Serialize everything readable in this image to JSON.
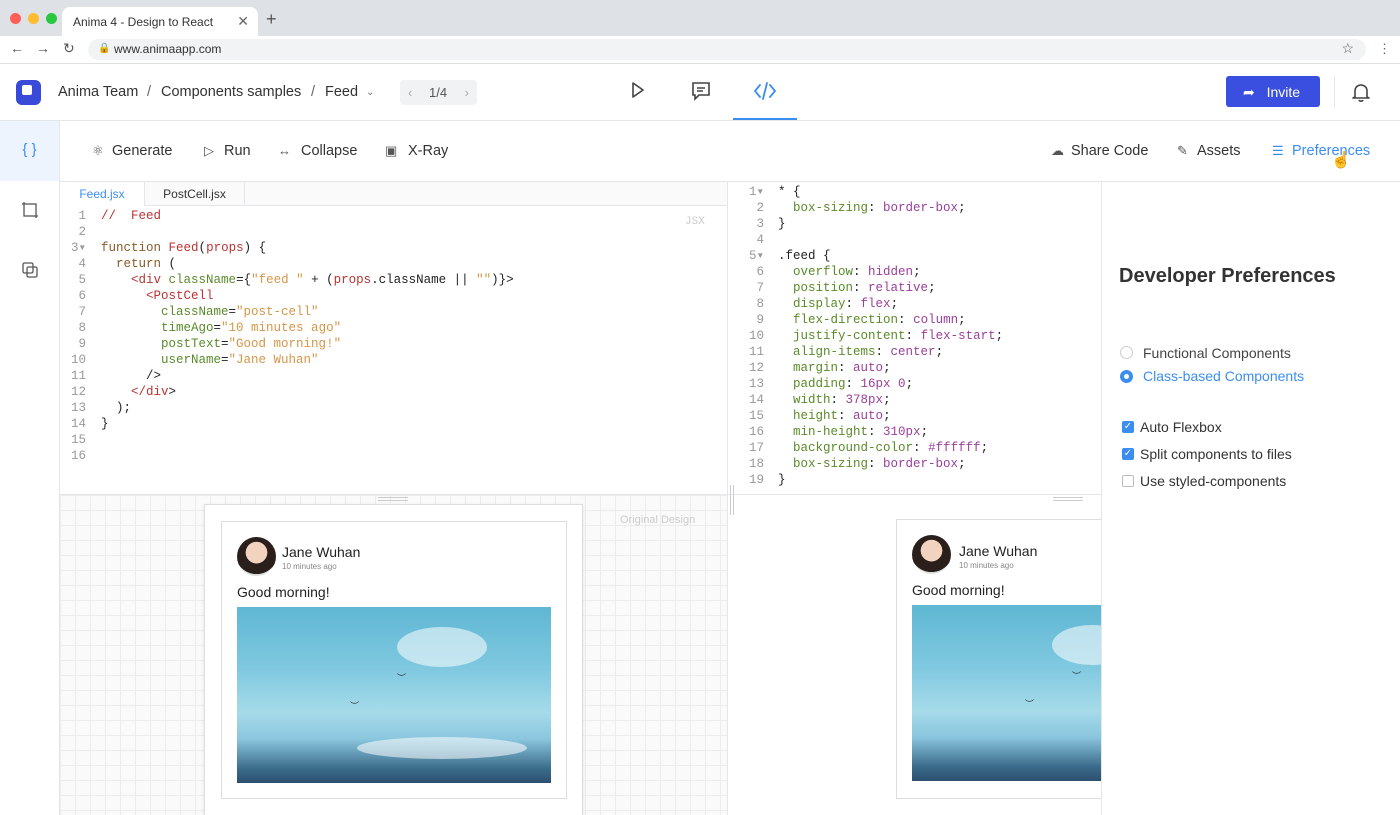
{
  "browser": {
    "tab_title": "Anima 4 - Design to React",
    "url": "www.animaapp.com"
  },
  "header": {
    "breadcrumb": [
      "Anima Team",
      "Components samples",
      "Feed"
    ],
    "breadcrumb_separator": "/",
    "pager": "1/4",
    "invite_label": "Invite",
    "accent": "#3a4fe0"
  },
  "toolbar": {
    "left": [
      "Generate",
      "Run",
      "Collapse",
      "X-Ray"
    ],
    "right": [
      "Share Code",
      "Assets",
      "Preferences"
    ]
  },
  "file_tabs": [
    "Feed.jsx",
    "PostCell.jsx"
  ],
  "jsx_label": "JSX",
  "jsx_code": [
    "//  Feed",
    "",
    "function Feed(props) {",
    "  return (",
    "    <div className={\"feed \" + (props.className || \"\")}>",
    "      <PostCell",
    "        className=\"post-cell\"",
    "        timeAgo=\"10 minutes ago\"",
    "        postText=\"Good morning!\"",
    "        userName=\"Jane Wuhan\"",
    "      />",
    "    </div>",
    "  );",
    "}",
    "",
    ""
  ],
  "css_code": [
    "* {",
    "  box-sizing: border-box;",
    "}",
    "",
    ".feed {",
    "  overflow: hidden;",
    "  position: relative;",
    "  display: flex;",
    "  flex-direction: column;",
    "  justify-content: flex-start;",
    "  align-items: center;",
    "  margin: auto;",
    "  padding: 16px 0;",
    "  width: 378px;",
    "  height: auto;",
    "  min-height: 310px;",
    "  background-color: #ffffff;",
    "  box-sizing: border-box;",
    "}"
  ],
  "preview": {
    "original_label": "Original Design",
    "user_name": "Jane Wuhan",
    "time_ago": "10 minutes ago",
    "post_text": "Good morning!"
  },
  "preferences": {
    "title": "Developer Preferences",
    "radios": [
      {
        "label": "Functional Components",
        "selected": false
      },
      {
        "label": "Class-based Components",
        "selected": true
      }
    ],
    "checkboxes": [
      {
        "label": "Auto Flexbox",
        "checked": true
      },
      {
        "label": "Split components to files",
        "checked": true
      },
      {
        "label": "Use styled-components",
        "checked": false
      }
    ]
  },
  "rail": [
    {
      "icon": "braces-icon",
      "active": true
    },
    {
      "icon": "frame-icon",
      "active": false
    },
    {
      "icon": "layers-icon",
      "active": false
    }
  ]
}
